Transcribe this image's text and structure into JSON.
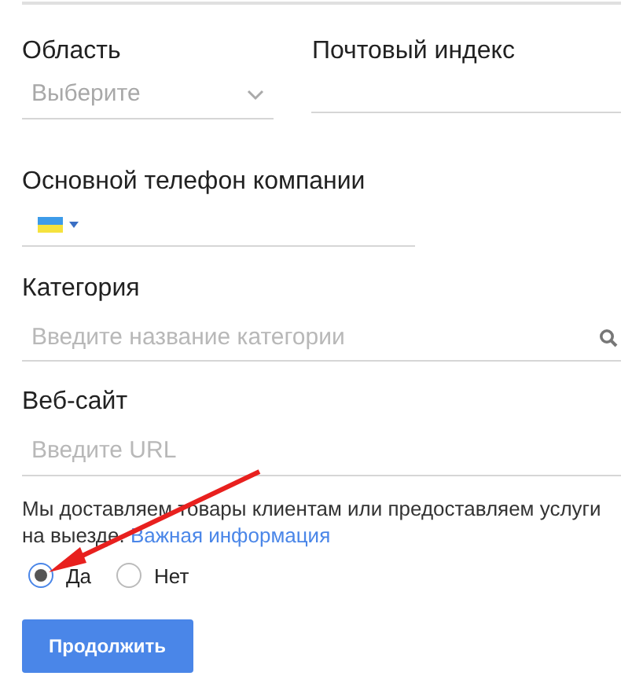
{
  "region": {
    "label": "Область",
    "placeholder": "Выберите"
  },
  "postal": {
    "label": "Почтовый индекс"
  },
  "phone": {
    "label": "Основной телефон компании"
  },
  "category": {
    "label": "Категория",
    "placeholder": "Введите название категории"
  },
  "website": {
    "label": "Веб-сайт",
    "placeholder": "Введите URL"
  },
  "delivery": {
    "question": "Мы доставляем товары клиентам или предоставляем услуги на выезде.",
    "link": "Важная информация",
    "options": [
      {
        "label": "Да",
        "selected": true
      },
      {
        "label": "Нет",
        "selected": false
      }
    ]
  },
  "button": "Продолжить"
}
